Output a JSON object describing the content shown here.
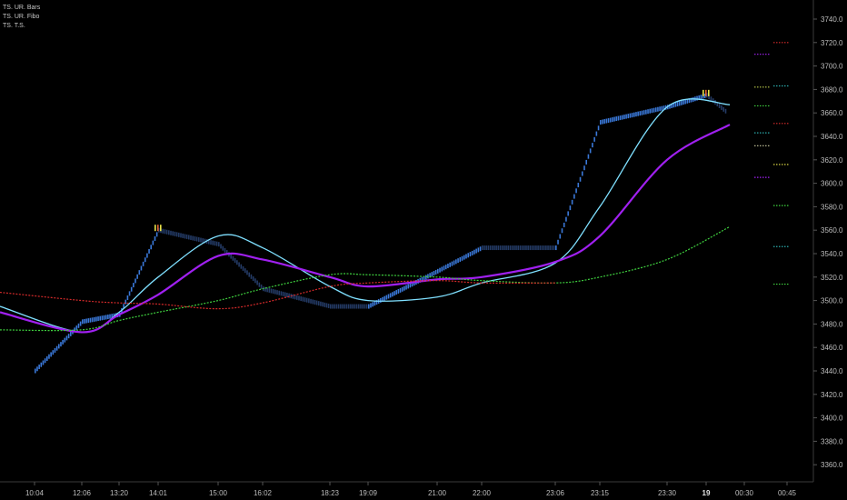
{
  "legend": [
    {
      "label": "TS. UR. Bars"
    },
    {
      "label": "TS. UR. Fibo"
    },
    {
      "label": "TS. T.S."
    }
  ],
  "colors": {
    "background": "#000000",
    "axis_text": "#bdbdbd",
    "bar_up": "#3a78d8",
    "bar_down": "#243b66",
    "bar_pivot_top": "#e8e34a",
    "bar_pivot_bottom": "#e06030",
    "line_cyan": "#7fe0ff",
    "line_purple": "#a020f0",
    "line_green": "#3ecf3e",
    "line_red": "#d42a2a"
  },
  "chart_data": {
    "type": "line",
    "title": "",
    "xlabel": "",
    "ylabel": "",
    "ylim": [
      3350,
      3750
    ],
    "grid": false,
    "x_ticks": [
      "10:04",
      "12:06",
      "13:20",
      "14:01",
      "15:00",
      "16:02",
      "18:23",
      "19:09",
      "21:00",
      "22:00",
      "23:06",
      "23:15",
      "23:30",
      "19",
      "00:30",
      "00:45"
    ],
    "y_ticks": [
      "3740.0",
      "3720.0",
      "3700.0",
      "3680.0",
      "3660.0",
      "3640.0",
      "3620.0",
      "3600.0",
      "3580.0",
      "3560.0",
      "3540.0",
      "3520.0",
      "3500.0",
      "3480.0",
      "3460.0",
      "3440.0",
      "3420.0",
      "3400.0",
      "3380.0",
      "3360.0"
    ],
    "price_path": {
      "x": [
        "10:04",
        "12:06",
        "13:20",
        "14:01",
        "15:00",
        "16:02",
        "18:23",
        "19:09",
        "21:00",
        "22:00",
        "23:06",
        "23:15",
        "23:30",
        "19",
        "00:30"
      ],
      "y": [
        3440,
        3482,
        3488,
        3560,
        3548,
        3510,
        3495,
        3495,
        3525,
        3545,
        3545,
        3652,
        3665,
        3675,
        3660
      ]
    },
    "series": [
      {
        "x": [
          "10:04",
          "12:06",
          "13:20",
          "14:01",
          "15:00",
          "16:02",
          "18:23",
          "19:09",
          "21:00",
          "22:00",
          "23:06",
          "23:15",
          "23:30",
          "19"
        ],
        "y": [
          3495,
          3473,
          3490,
          3520,
          3555,
          3545,
          3512,
          3500,
          3503,
          3515,
          3532,
          3580,
          3665,
          3667
        ]
      },
      {
        "x": [
          "10:04",
          "12:06",
          "13:20",
          "14:01",
          "15:00",
          "16:02",
          "18:23",
          "19:09",
          "21:00",
          "22:00",
          "23:06",
          "23:15",
          "23:30",
          "19"
        ],
        "y": [
          3490,
          3473,
          3488,
          3505,
          3538,
          3535,
          3520,
          3512,
          3518,
          3520,
          3533,
          3555,
          3620,
          3650
        ]
      },
      {
        "x": [
          "10:04",
          "12:06",
          "13:20",
          "14:01",
          "15:00",
          "16:02",
          "18:23",
          "19:09",
          "21:00",
          "22:00",
          "23:06",
          "23:15",
          "23:30",
          "19"
        ],
        "y": [
          3475,
          3475,
          3483,
          3490,
          3500,
          3510,
          3522,
          3522,
          3520,
          3517,
          3515,
          3520,
          3535,
          3563
        ]
      },
      {
        "x": [
          "10:04",
          "12:06",
          "13:20",
          "14:01",
          "15:00",
          "16:02",
          "18:23",
          "19:09",
          "21:00",
          "22:00",
          "23:06"
        ],
        "y": [
          3507,
          3500,
          3498,
          3497,
          3493,
          3498,
          3512,
          3515,
          3517,
          3515,
          3515
        ]
      }
    ],
    "levels_right": [
      {
        "y": 3720,
        "color": "#d42a2a"
      },
      {
        "y": 3710,
        "color": "#a020f0"
      },
      {
        "y": 3683,
        "color": "#2aa8a8"
      },
      {
        "y": 3682,
        "color": "#b8c84a"
      },
      {
        "y": 3666,
        "color": "#3ecf3e"
      },
      {
        "y": 3651,
        "color": "#d42a2a"
      },
      {
        "y": 3643,
        "color": "#2aa8a8"
      },
      {
        "y": 3632,
        "color": "#c8c8a0"
      },
      {
        "y": 3616,
        "color": "#e8e34a"
      },
      {
        "y": 3605,
        "color": "#a020f0"
      },
      {
        "y": 3581,
        "color": "#3ecf3e"
      },
      {
        "y": 3546,
        "color": "#2aa8a8"
      },
      {
        "y": 3514,
        "color": "#3ecf3e"
      }
    ]
  }
}
